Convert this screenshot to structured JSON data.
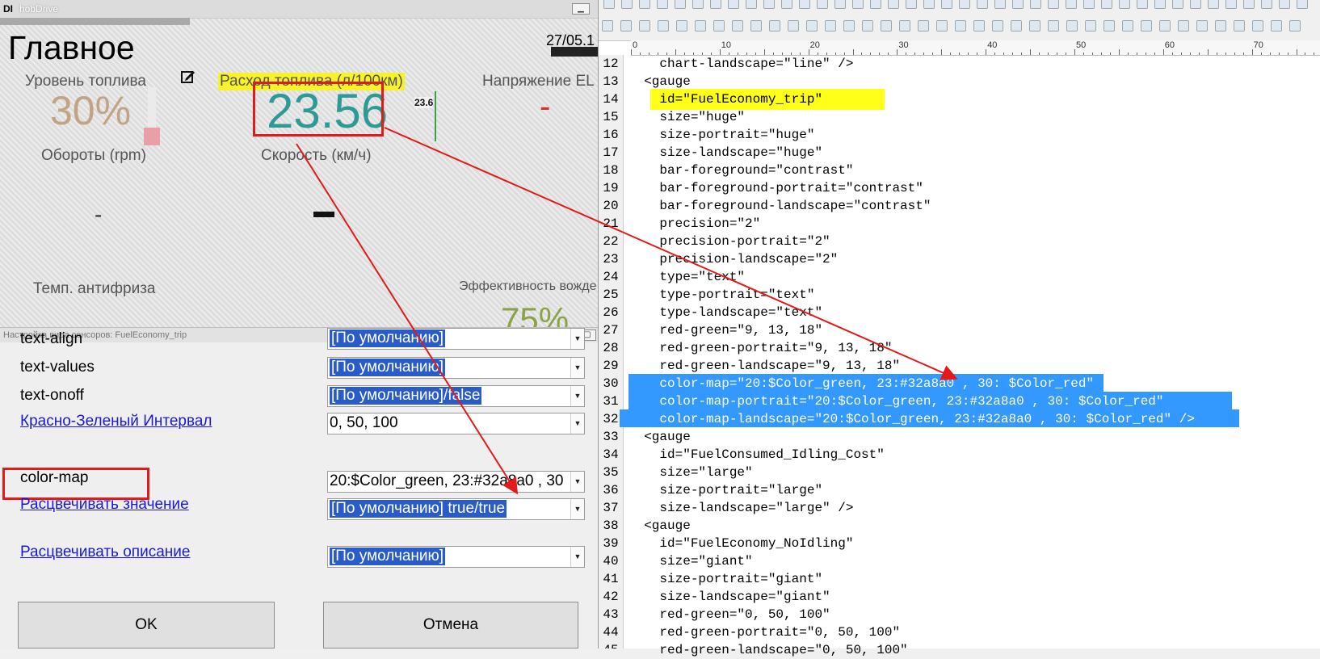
{
  "hobdrive": {
    "logo": "DI",
    "window_title": "hobDrive",
    "main_title": "Главное",
    "date": "27/05.1",
    "gauges": {
      "fuel_level_label": "Уровень топлива",
      "fuel_level_value": "30%",
      "fuel_economy_label": "Расход топлива (л/100км)",
      "fuel_economy_value": "23.56",
      "mini_value": "23.6",
      "voltage_label": "Напряжение EL",
      "voltage_value": "-",
      "rpm_label": "Обороты (rpm)",
      "rpm_value": "-",
      "speed_label": "Скорость (км/ч)",
      "antifreeze_label": "Темп. антифриза",
      "efficiency_label": "Эффективность вожде",
      "efficiency_value": "75%"
    }
  },
  "dialog": {
    "title": "Настройка вида сенсоров: FuelEconomy_trip",
    "rows": [
      {
        "label": "text-align",
        "value": "[По умолчанию]"
      },
      {
        "label": "text-values",
        "value": "[По умолчанию]"
      },
      {
        "label": "text-onoff",
        "value": "[По умолчанию]/false"
      },
      {
        "label": "Красно-Зеленый Интервал",
        "value": "0, 50, 100"
      },
      {
        "label": "color-map",
        "value": "20:$Color_green, 23:#32a8a0 , 30"
      },
      {
        "label": "Расцвечивать значение",
        "value": "[По умолчанию] true/true"
      },
      {
        "label": "Расцвечивать описание",
        "value": "[По умолчанию]"
      }
    ],
    "ok_label": "OK",
    "cancel_label": "Отмена"
  },
  "editor": {
    "ruler": [
      "0",
      "10",
      "20",
      "30",
      "40",
      "50",
      "60",
      "70"
    ],
    "lines": [
      {
        "n": "12",
        "text": "    chart-landscape=\"line\" />"
      },
      {
        "n": "13",
        "text": "  <gauge"
      },
      {
        "n": "14",
        "text": "    id=\"FuelEconomy_trip\""
      },
      {
        "n": "15",
        "text": "    size=\"huge\""
      },
      {
        "n": "16",
        "text": "    size-portrait=\"huge\""
      },
      {
        "n": "17",
        "text": "    size-landscape=\"huge\""
      },
      {
        "n": "18",
        "text": "    bar-foreground=\"contrast\""
      },
      {
        "n": "19",
        "text": "    bar-foreground-portrait=\"contrast\""
      },
      {
        "n": "20",
        "text": "    bar-foreground-landscape=\"contrast\""
      },
      {
        "n": "21",
        "text": "    precision=\"2\""
      },
      {
        "n": "22",
        "text": "    precision-portrait=\"2\""
      },
      {
        "n": "23",
        "text": "    precision-landscape=\"2\""
      },
      {
        "n": "24",
        "text": "    type=\"text\""
      },
      {
        "n": "25",
        "text": "    type-portrait=\"text\""
      },
      {
        "n": "26",
        "text": "    type-landscape=\"text\""
      },
      {
        "n": "27",
        "text": "    red-green=\"9, 13, 18\""
      },
      {
        "n": "28",
        "text": "    red-green-portrait=\"9, 13, 18\""
      },
      {
        "n": "29",
        "text": "    red-green-landscape=\"9, 13, 18\""
      },
      {
        "n": "30",
        "text": "    color-map=\"20:$Color_green, 23:#32a8a0 , 30: $Color_red\""
      },
      {
        "n": "31",
        "text": "    color-map-portrait=\"20:$Color_green, 23:#32a8a0 , 30: $Color_red\""
      },
      {
        "n": "32",
        "text": "    color-map-landscape=\"20:$Color_green, 23:#32a8a0 , 30: $Color_red\" />"
      },
      {
        "n": "33",
        "text": "  <gauge"
      },
      {
        "n": "34",
        "text": "    id=\"FuelConsumed_Idling_Cost\""
      },
      {
        "n": "35",
        "text": "    size=\"large\""
      },
      {
        "n": "36",
        "text": "    size-portrait=\"large\""
      },
      {
        "n": "37",
        "text": "    size-landscape=\"large\" />"
      },
      {
        "n": "38",
        "text": "  <gauge"
      },
      {
        "n": "39",
        "text": "    id=\"FuelEconomy_NoIdling\""
      },
      {
        "n": "40",
        "text": "    size=\"giant\""
      },
      {
        "n": "41",
        "text": "    size-portrait=\"giant\""
      },
      {
        "n": "42",
        "text": "    size-landscape=\"giant\""
      },
      {
        "n": "43",
        "text": "    red-green=\"0, 50, 100\""
      },
      {
        "n": "44",
        "text": "    red-green-portrait=\"0, 50, 100\""
      },
      {
        "n": "45",
        "text": "    red-green-landscape=\"0, 50, 100\""
      }
    ]
  },
  "colors": {
    "accent_teal": "#2e9a93",
    "highlight_yellow": "#f8f22a",
    "annotation_red": "#e21a1a",
    "selection_blue": "#3399ff"
  }
}
